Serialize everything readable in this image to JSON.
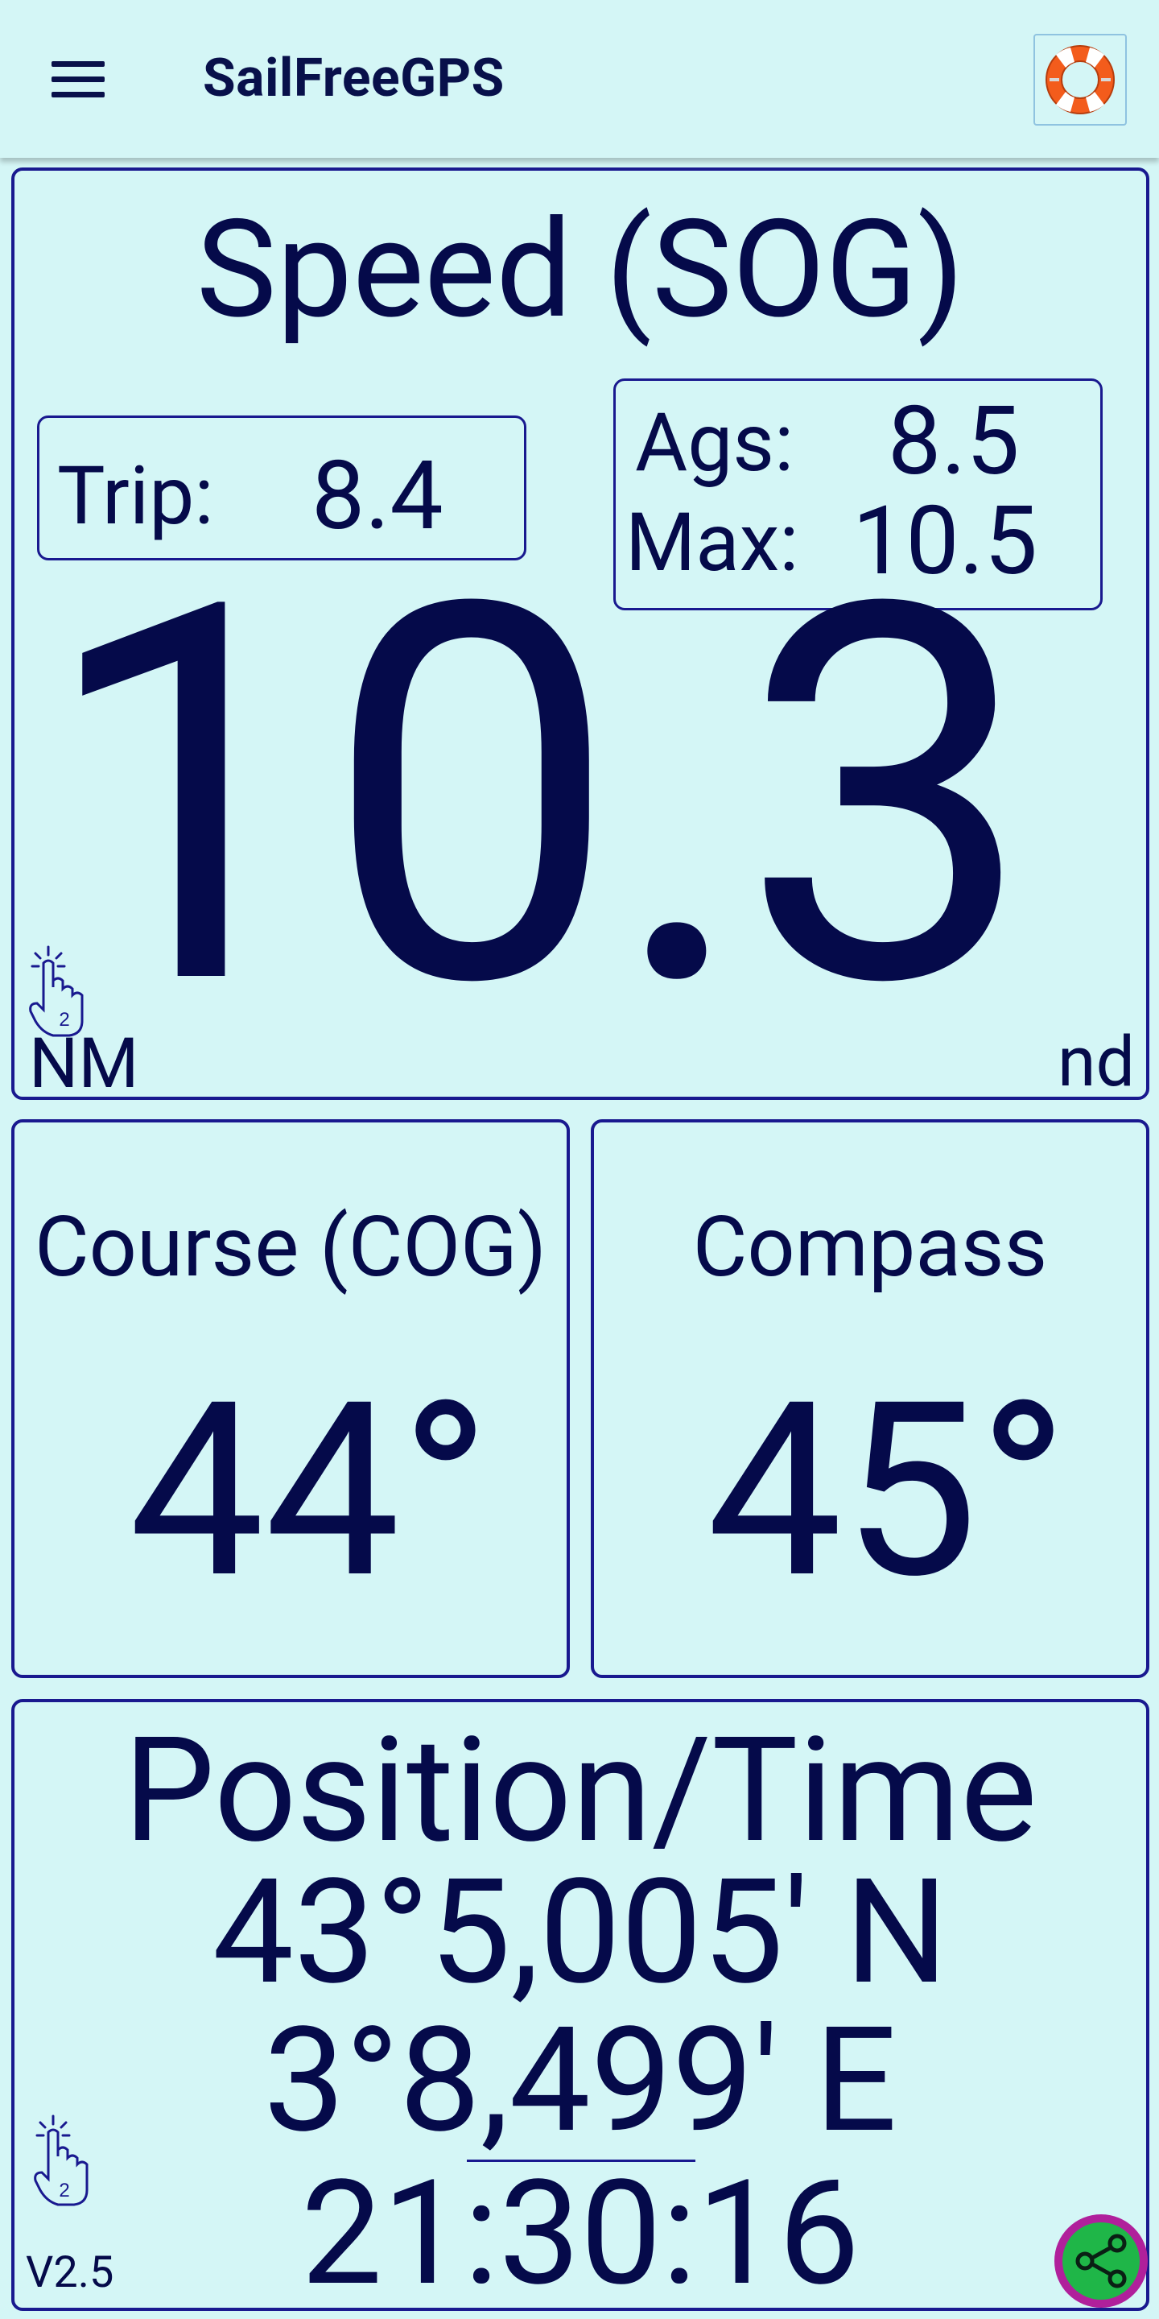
{
  "app_bar": {
    "title": "SailFreeGPS",
    "menu_icon": "hamburger-menu-icon",
    "help_icon": "lifebuoy-icon"
  },
  "speed_panel": {
    "title": "Speed (SOG)",
    "trip_label": "Trip:",
    "trip_value": "8.4",
    "avg_label": "Ags:",
    "avg_value": "8.5",
    "max_label": "Max:",
    "max_value": "10.5",
    "value": "10.3",
    "trip_unit": "NM",
    "unit": "nd",
    "tap_icon": "double-tap-icon",
    "tap_count": "2"
  },
  "course_panel": {
    "title": "Course (COG)",
    "value": "44°"
  },
  "compass_panel": {
    "title": "Compass",
    "value": "45°"
  },
  "position_panel": {
    "title": "Position/Time",
    "latitude": "43°5,005' N",
    "longitude": "3°8,499' E",
    "time": "21:30:16",
    "version": "V2.5",
    "tap_icon": "double-tap-icon",
    "tap_count": "2",
    "share_icon": "share-icon"
  },
  "colors": {
    "background": "#d4f6f6",
    "text": "#050a4a",
    "border": "#19198f",
    "share_ring": "#b0209b",
    "share_fill": "#1fb648"
  }
}
